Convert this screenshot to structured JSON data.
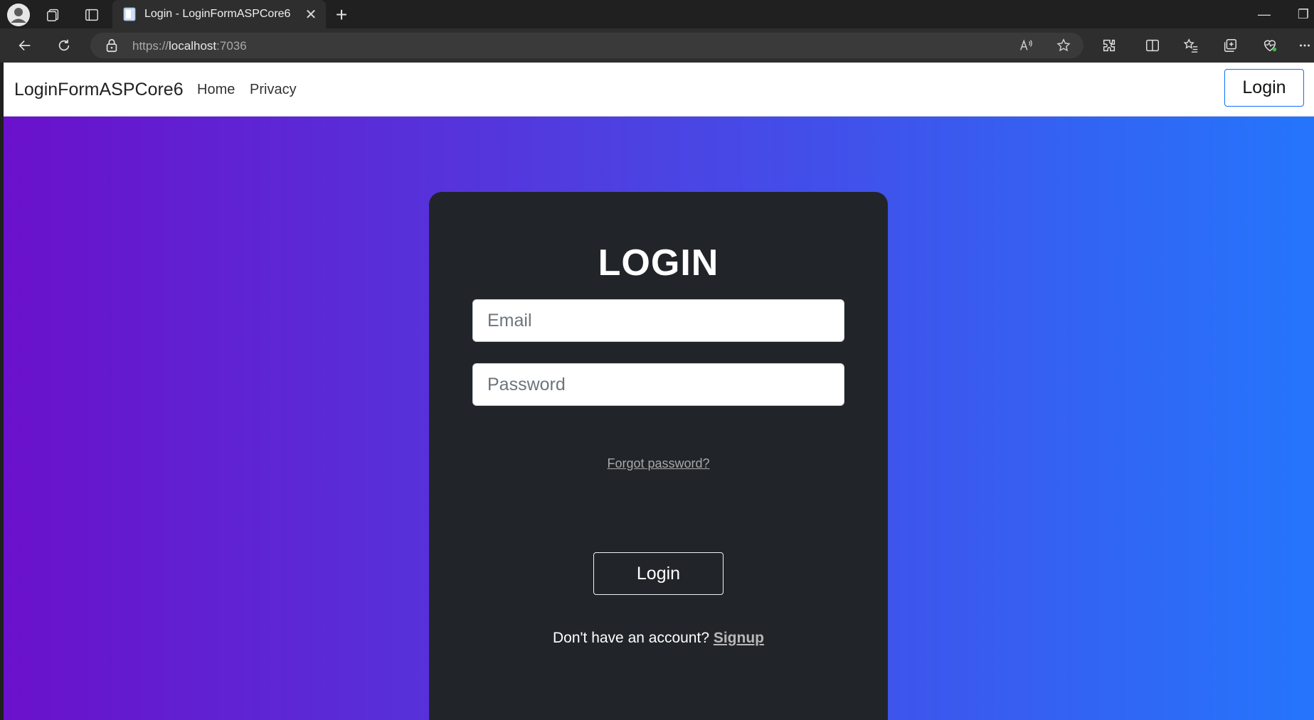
{
  "browser": {
    "tab_title": "Login - LoginFormASPCore6",
    "tab_close": "✕",
    "new_tab": "+",
    "url_scheme": "https://",
    "url_host": "localhost",
    "url_port": ":7036",
    "window_minimize": "—",
    "window_restore": "❐",
    "icons": [
      "profile-icon",
      "workspaces-icon",
      "tab-actions-icon",
      "back-icon",
      "refresh-icon",
      "lock-icon",
      "read-aloud-icon",
      "favorite-star-icon",
      "extensions-icon",
      "split-screen-icon",
      "favorites-icon",
      "collections-icon",
      "browser-essentials-icon",
      "more-icon"
    ]
  },
  "navbar": {
    "brand": "LoginFormASPCore6",
    "links": [
      "Home",
      "Privacy"
    ],
    "login_button": "Login",
    "login_border_color": "#0d6efd"
  },
  "hero": {
    "gradient_start": "#6a11cb",
    "gradient_end": "#2575fc"
  },
  "login_card": {
    "title": "LOGIN",
    "email_placeholder": "Email",
    "password_placeholder": "Password",
    "forgot_password": "Forgot password?",
    "login_button": "Login",
    "signup_prompt": "Don't have an account?",
    "signup_link": "Signup",
    "background": "#212529"
  }
}
